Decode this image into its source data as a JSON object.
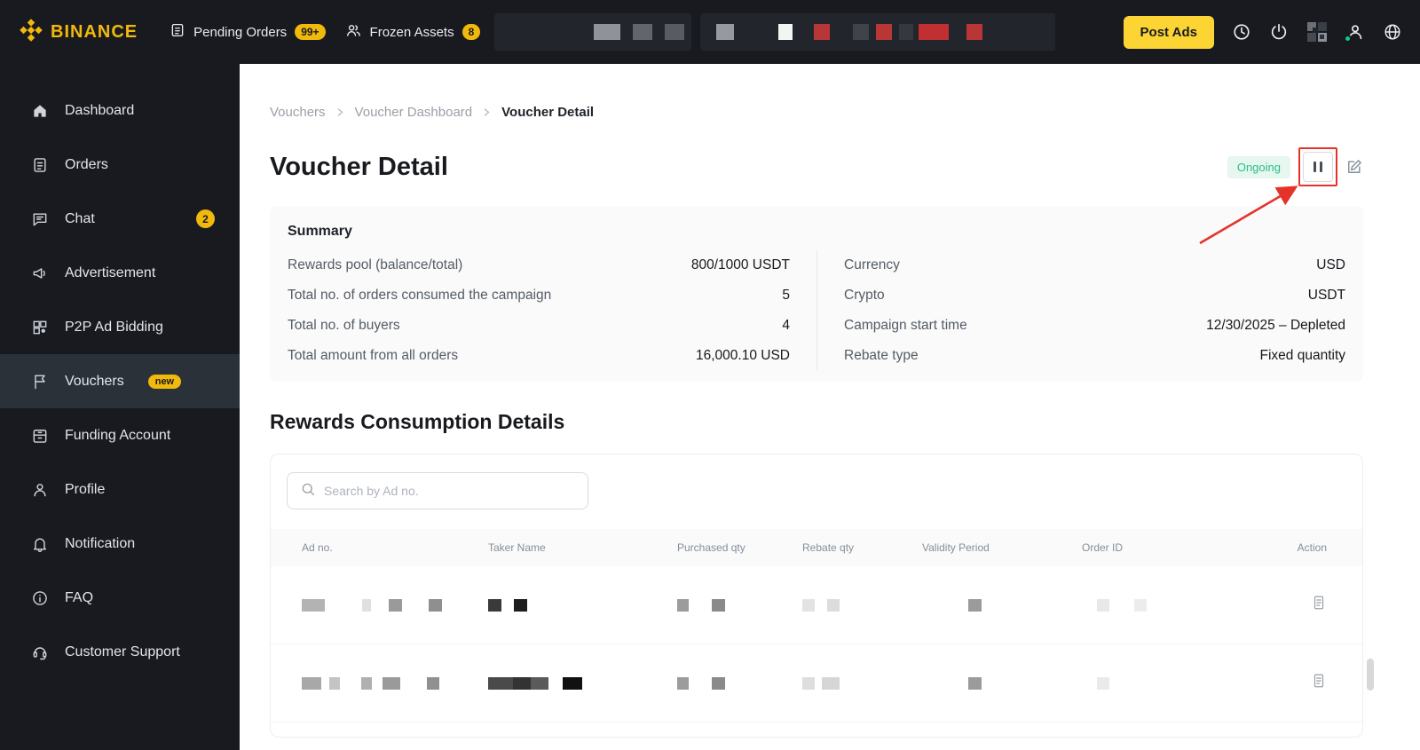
{
  "topbar": {
    "brand": "BINANCE",
    "pending_orders": {
      "label": "Pending Orders",
      "badge": "99+"
    },
    "frozen_assets": {
      "label": "Frozen Assets",
      "badge": "8"
    },
    "post_ads": "Post Ads"
  },
  "sidebar": {
    "items": [
      {
        "label": "Dashboard"
      },
      {
        "label": "Orders"
      },
      {
        "label": "Chat",
        "badge": "2"
      },
      {
        "label": "Advertisement"
      },
      {
        "label": "P2P Ad Bidding"
      },
      {
        "label": "Vouchers",
        "badge": "new"
      },
      {
        "label": "Funding Account"
      },
      {
        "label": "Profile"
      },
      {
        "label": "Notification"
      },
      {
        "label": "FAQ"
      },
      {
        "label": "Customer Support"
      }
    ]
  },
  "breadcrumb": [
    "Vouchers",
    "Voucher Dashboard",
    "Voucher Detail"
  ],
  "page": {
    "title": "Voucher Detail",
    "status": "Ongoing"
  },
  "summary": {
    "title": "Summary",
    "left": [
      {
        "label": "Rewards pool (balance/total)",
        "value": "800/1000 USDT"
      },
      {
        "label": "Total no. of orders consumed the campaign",
        "value": "5"
      },
      {
        "label": "Total no. of buyers",
        "value": "4"
      },
      {
        "label": "Total amount from all orders",
        "value": "16,000.10 USD"
      }
    ],
    "right": [
      {
        "label": "Currency",
        "value": "USD"
      },
      {
        "label": "Crypto",
        "value": "USDT"
      },
      {
        "label": "Campaign start time",
        "value": "12/30/2025 – Depleted"
      },
      {
        "label": "Rebate type",
        "value": "Fixed quantity"
      }
    ]
  },
  "rewards": {
    "title": "Rewards Consumption Details",
    "search_placeholder": "Search by Ad no.",
    "headers": [
      "Ad no.",
      "Taker Name",
      "Purchased qty",
      "Rebate qty",
      "Validity Period",
      "Order ID",
      "Action"
    ]
  },
  "colors": {
    "brand_yellow": "#F0B90B",
    "button_yellow": "#FCD535",
    "status_green": "#2EBD85",
    "annotation_red": "#E5332A",
    "dark_bg": "#181A20"
  }
}
